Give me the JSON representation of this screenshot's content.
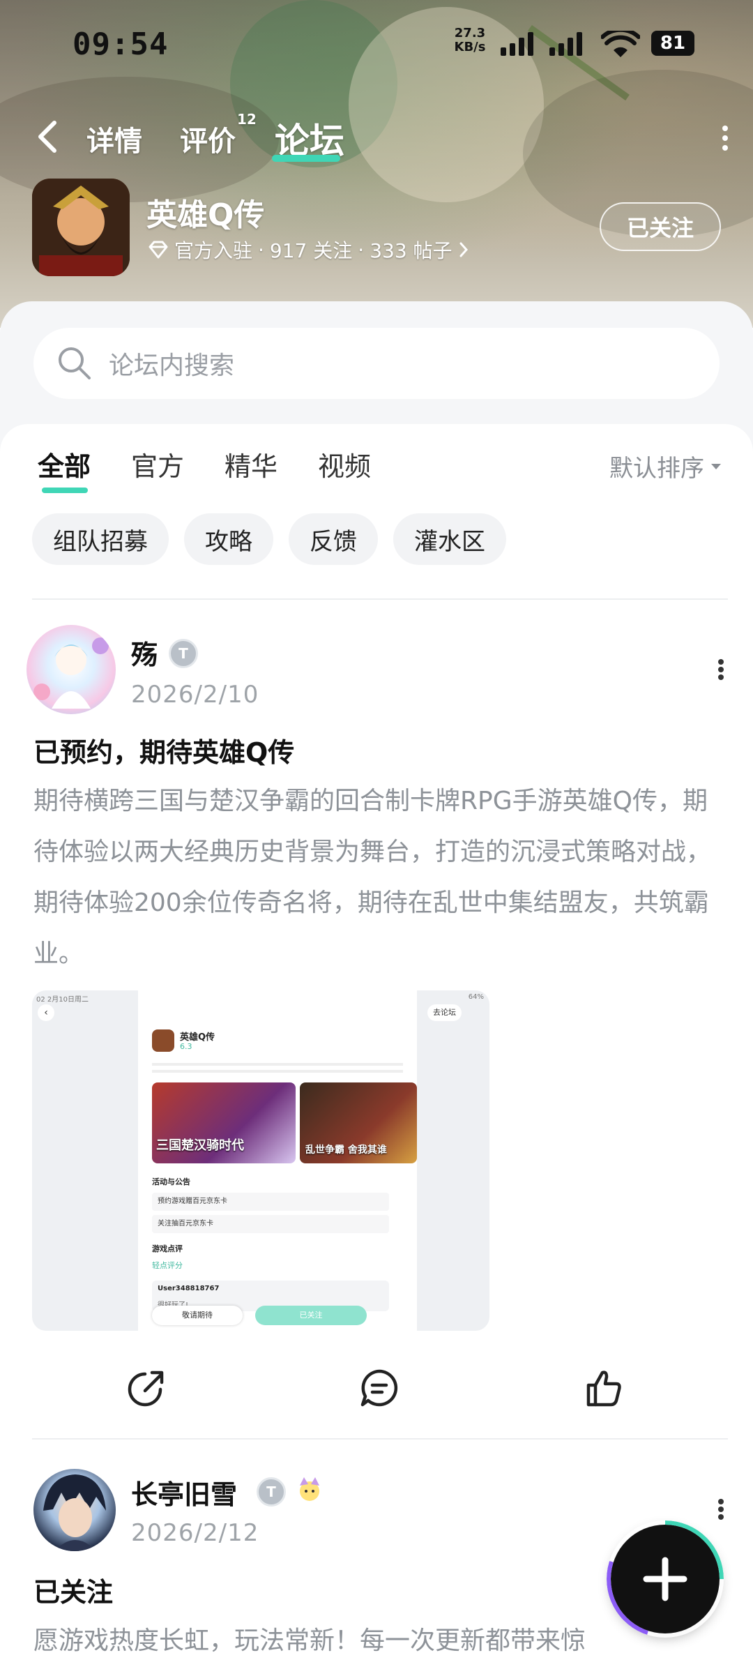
{
  "status_bar": {
    "time": "09:54",
    "net_speed": "27.3",
    "net_unit": "KB/s",
    "battery": "81"
  },
  "nav": {
    "tabs": [
      {
        "label": "详情"
      },
      {
        "label": "评价",
        "badge": "12"
      },
      {
        "label": "论坛"
      }
    ]
  },
  "app": {
    "name": "英雄Q传",
    "official": "官方入驻",
    "followers": "917 关注",
    "posts": "333 帖子",
    "follow_state": "已关注"
  },
  "search": {
    "placeholder": "论坛内搜索"
  },
  "forum_tabs": [
    "全部",
    "官方",
    "精华",
    "视频"
  ],
  "sort_label": "默认排序",
  "chips": [
    "组队招募",
    "攻略",
    "反馈",
    "灌水区"
  ],
  "posts": [
    {
      "user": "殇",
      "date": "2026/2/10",
      "title": "已预约，期待英雄Q传",
      "body": "期待横跨三国与楚汉争霸的回合制卡牌RPG手游英雄Q传，期待体验以两大经典历史背景为舞台，打造的沉浸式策略对战，期待体验200余位传奇名将，期待在乱世中集结盟友，共筑霸业。",
      "screenshot": {
        "statusbar_left": "02 2月10日周二",
        "statusbar_right": "64%",
        "forum_btn": "去论坛",
        "app_name": "英雄Q传",
        "rating": "6.3",
        "banner_left": "三国楚汉骑时代",
        "banner_right": "乱世争霸 舍我其谁",
        "section_activity": "活动与公告",
        "activity_items": [
          "预约游戏赠百元京东卡",
          "关注抽百元京东卡"
        ],
        "section_review": "游戏点评",
        "review_label": "轻点评分",
        "reviewer": "User348818767",
        "reviewer_text": "很好玩了!",
        "btn_left": "敬请期待",
        "btn_right": "已关注"
      }
    },
    {
      "user": "长亭旧雪",
      "date": "2026/2/12",
      "title": "已关注",
      "body": "愿游戏热度长虹，玩法常新！每一次更新都带来惊"
    }
  ],
  "colors": {
    "accent": "#3fd6b6",
    "muted_text": "#8d9298"
  }
}
